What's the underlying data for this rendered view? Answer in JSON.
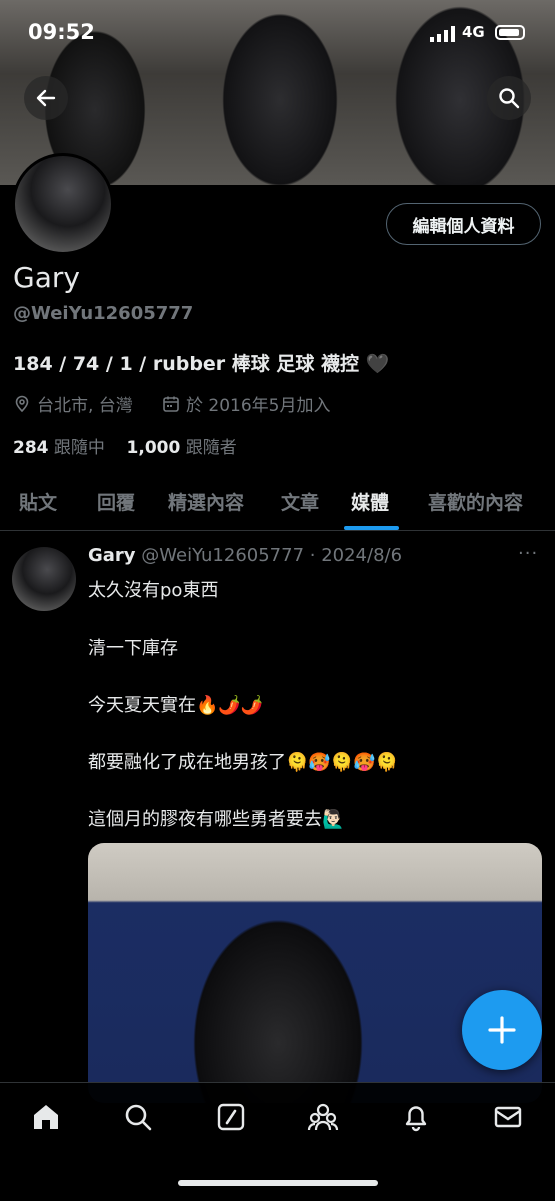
{
  "status_bar": {
    "time": "09:52",
    "network": "4G"
  },
  "profile": {
    "edit_label": "編輯個人資料",
    "name": "Gary",
    "handle": "@WeiYu12605777",
    "bio": "184 / 74 / 1 / rubber 棒球 足球 襪控 🖤",
    "location": "台北市, 台灣",
    "joined": "於 2016年5月加入",
    "following_count": "284",
    "following_label": "跟隨中",
    "followers_count": "1,000",
    "followers_label": "跟隨者"
  },
  "tabs": [
    {
      "label": "貼文"
    },
    {
      "label": "回覆"
    },
    {
      "label": "精選內容"
    },
    {
      "label": "文章"
    },
    {
      "label": "媒體"
    },
    {
      "label": "喜歡的內容"
    }
  ],
  "active_tab": "媒體",
  "post": {
    "name": "Gary",
    "meta": "@WeiYu12605777 · 2024/8/6",
    "more": "···",
    "lines": [
      "太久沒有po東西",
      "清一下庫存",
      "今天夏天實在🔥🌶️🌶️",
      "都要融化了成在地男孩了🫠🥵🫠🥵🫠",
      "這個月的膠夜有哪些勇者要去🙋🏻‍♂️"
    ]
  },
  "icons": {
    "back": "back-arrow-icon",
    "search": "search-icon",
    "location": "location-pin-icon",
    "calendar": "calendar-icon",
    "fab": "compose-plus-icon",
    "nav": [
      "home-icon",
      "search-icon",
      "grok-icon",
      "communities-icon",
      "notifications-icon",
      "messages-icon"
    ]
  },
  "colors": {
    "accent": "#1d9bf0",
    "muted": "#71767b",
    "background": "#000000"
  }
}
